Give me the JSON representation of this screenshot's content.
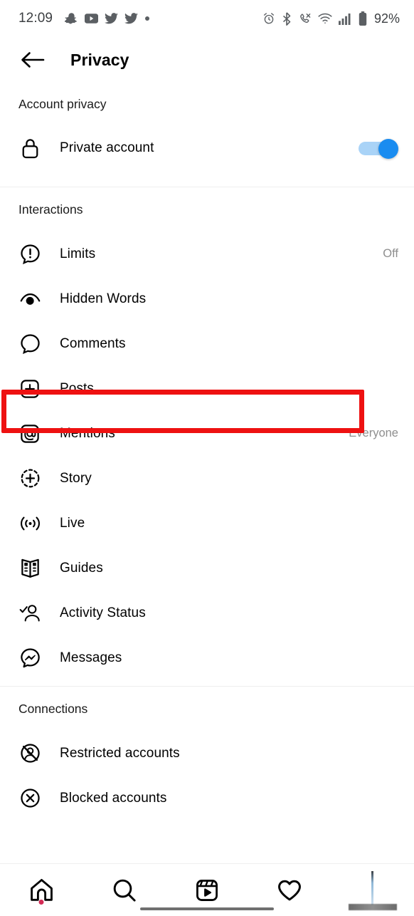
{
  "status_bar": {
    "time": "12:09",
    "battery_text": "92%",
    "left_icons": [
      "snapchat-icon",
      "youtube-icon",
      "twitter-icon",
      "twitter-icon",
      "dot-icon"
    ],
    "right_icons": [
      "alarm-icon",
      "bluetooth-icon",
      "call-mute-icon",
      "wifi-icon",
      "cellular-signal-icon",
      "battery-icon"
    ]
  },
  "app_bar": {
    "back_icon": "back-arrow-icon",
    "title": "Privacy"
  },
  "sections": [
    {
      "id": "account-privacy",
      "header": "Account privacy",
      "rows": [
        {
          "id": "private-account",
          "icon": "lock-icon",
          "label": "Private account",
          "control": "toggle",
          "toggle_on": true,
          "value": ""
        }
      ]
    },
    {
      "id": "interactions",
      "header": "Interactions",
      "rows": [
        {
          "id": "limits",
          "icon": "limits-bubble-icon",
          "label": "Limits",
          "control": "value",
          "value": "Off"
        },
        {
          "id": "hidden-words",
          "icon": "hidden-words-eye-icon",
          "label": "Hidden Words",
          "control": "none",
          "value": "",
          "highlighted": true
        },
        {
          "id": "comments",
          "icon": "comment-bubble-icon",
          "label": "Comments",
          "control": "none",
          "value": ""
        },
        {
          "id": "posts",
          "icon": "plus-square-icon",
          "label": "Posts",
          "control": "none",
          "value": ""
        },
        {
          "id": "mentions",
          "icon": "at-sign-icon",
          "label": "Mentions",
          "control": "value",
          "value": "Everyone"
        },
        {
          "id": "story",
          "icon": "story-plus-icon",
          "label": "Story",
          "control": "none",
          "value": ""
        },
        {
          "id": "live",
          "icon": "live-broadcast-icon",
          "label": "Live",
          "control": "none",
          "value": ""
        },
        {
          "id": "guides",
          "icon": "guides-book-icon",
          "label": "Guides",
          "control": "none",
          "value": ""
        },
        {
          "id": "activity-status",
          "icon": "activity-status-icon",
          "label": "Activity Status",
          "control": "none",
          "value": ""
        },
        {
          "id": "messages",
          "icon": "messenger-icon",
          "label": "Messages",
          "control": "none",
          "value": ""
        }
      ]
    },
    {
      "id": "connections",
      "header": "Connections",
      "rows": [
        {
          "id": "restricted-accounts",
          "icon": "restricted-account-icon",
          "label": "Restricted accounts",
          "control": "none",
          "value": ""
        },
        {
          "id": "blocked-accounts",
          "icon": "blocked-account-icon",
          "label": "Blocked accounts",
          "control": "none",
          "value": ""
        }
      ]
    }
  ],
  "bottom_nav": {
    "items": [
      {
        "id": "home",
        "icon": "home-icon",
        "badge": true
      },
      {
        "id": "search",
        "icon": "search-icon",
        "badge": false
      },
      {
        "id": "reels",
        "icon": "reels-icon",
        "badge": false
      },
      {
        "id": "likes",
        "icon": "heart-icon",
        "badge": false
      },
      {
        "id": "profile",
        "icon": "avatar-icon",
        "badge": false
      }
    ]
  },
  "annotation": {
    "type": "rectangle-highlight",
    "color": "#ee1111",
    "target_row": "hidden-words"
  },
  "colors": {
    "accent_toggle": "#1a8cf0",
    "toggle_track": "#a9d3f7",
    "secondary_text": "#8e8e8e",
    "highlight": "#ee1111",
    "badge": "#d42b55"
  }
}
